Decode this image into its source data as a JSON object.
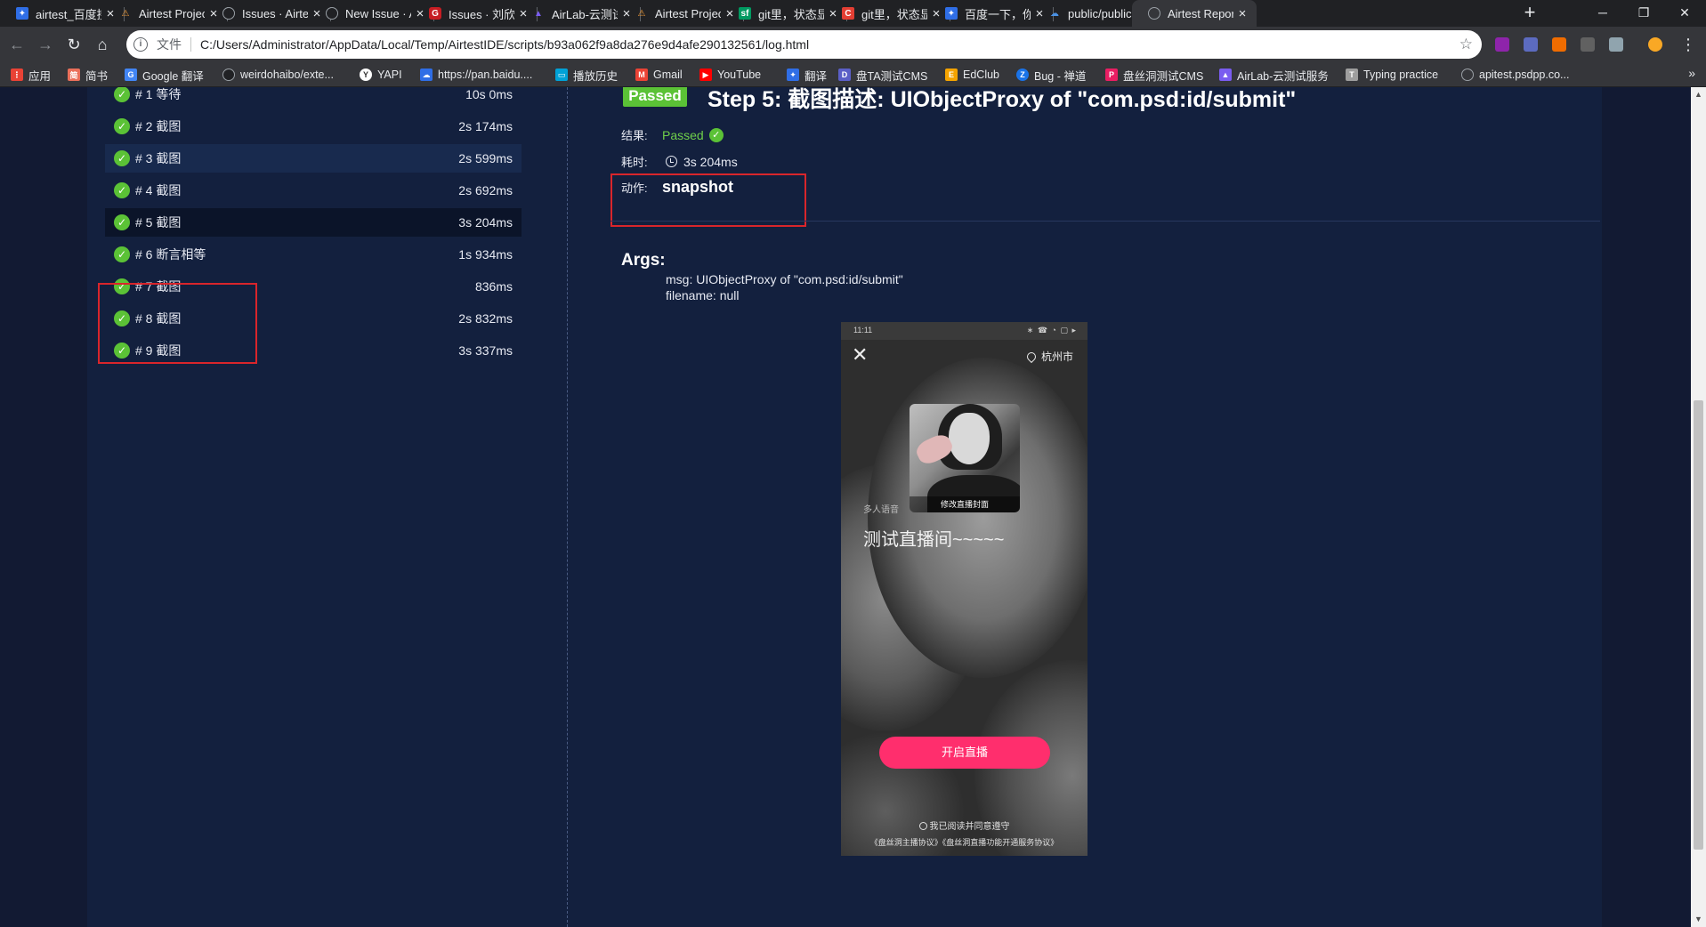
{
  "browser": {
    "tabs": [
      {
        "label": "airtest_百度搜索",
        "icon": "baidu-icon",
        "color": "#2f6ee6"
      },
      {
        "label": "Airtest Project",
        "icon": "airtest-icon",
        "color": "#f29c38"
      },
      {
        "label": "Issues · AirtestProject",
        "icon": "github-icon",
        "color": "#202124"
      },
      {
        "label": "New Issue · AirtestProject",
        "icon": "github-icon",
        "color": "#202124"
      },
      {
        "label": "Issues · 刘欣/AirLab",
        "icon": "gitee-icon",
        "color": "#c71d23"
      },
      {
        "label": "AirLab-云测试服务",
        "icon": "airlab-icon",
        "color": "#7a5cf0"
      },
      {
        "label": "Airtest Project",
        "icon": "airtest-icon",
        "color": "#f29c38"
      },
      {
        "label": "git里，状态显示",
        "icon": "segmentfault-icon",
        "color": "#009a61"
      },
      {
        "label": "git里，状态显示",
        "icon": "csdn-icon",
        "color": "#e33e33"
      },
      {
        "label": "百度一下，你就知道",
        "icon": "baidu-icon",
        "color": "#2f6ee6"
      },
      {
        "label": "public/public",
        "icon": "cloud-icon",
        "color": "#4a90e2"
      },
      {
        "label": "Airtest Report",
        "icon": "globe-icon",
        "color": "#9aa0a6"
      }
    ],
    "address": {
      "protocol_label": "文件",
      "url": "C:/Users/Administrator/AppData/Local/Temp/AirtestIDE/scripts/b93a062f9a8da276e9d4afe290132561/log.html"
    },
    "bookmarks": [
      {
        "label": "应用",
        "icon": "apps-icon",
        "color": "#e94235"
      },
      {
        "label": "简书",
        "icon": "jianshu-icon",
        "color": "#ea6f5a"
      },
      {
        "label": "Google 翻译",
        "icon": "google-translate-icon",
        "color": "#4285f4"
      },
      {
        "label": "weirdohaibo/exte...",
        "icon": "github-icon",
        "color": "#202124"
      },
      {
        "label": "YAPI",
        "icon": "yapi-icon",
        "color": "#ffffff"
      },
      {
        "label": "https://pan.baidu....",
        "icon": "baidu-pan-icon",
        "color": "#2f6ee6"
      },
      {
        "label": "播放历史",
        "icon": "bilibili-icon",
        "color": "#00a1d6"
      },
      {
        "label": "Gmail",
        "icon": "gmail-icon",
        "color": "#ea4335"
      },
      {
        "label": "YouTube",
        "icon": "youtube-icon",
        "color": "#ff0000"
      },
      {
        "label": "翻译",
        "icon": "baidu-translate-icon",
        "color": "#2f6ee6"
      },
      {
        "label": "盘TA测试CMS",
        "icon": "cms-icon",
        "color": "#5b5fc7"
      },
      {
        "label": "EdClub",
        "icon": "edclub-icon",
        "color": "#f4a300"
      },
      {
        "label": "Bug - 禅道",
        "icon": "zentao-icon",
        "color": "#1a73e8"
      },
      {
        "label": "盘丝洞测试CMS",
        "icon": "pansi-icon",
        "color": "#e91e63"
      },
      {
        "label": "AirLab-云测试服务",
        "icon": "airlab-icon",
        "color": "#7a5cf0"
      },
      {
        "label": "Typing practice",
        "icon": "typing-icon",
        "color": "#9e9e9e"
      },
      {
        "label": "apitest.psdpp.co...",
        "icon": "globe-icon",
        "color": "#9aa0a6"
      }
    ]
  },
  "steps": [
    {
      "label": "# 1  等待",
      "duration": "10s 0ms"
    },
    {
      "label": "# 2  截图",
      "duration": "2s 174ms"
    },
    {
      "label": "# 3  截图",
      "duration": "2s 599ms"
    },
    {
      "label": "# 4  截图",
      "duration": "2s 692ms"
    },
    {
      "label": "# 5  截图",
      "duration": "3s 204ms"
    },
    {
      "label": "# 6  断言相等",
      "duration": "1s 934ms"
    },
    {
      "label": "# 7  截图",
      "duration": "836ms"
    },
    {
      "label": "# 8  截图",
      "duration": "2s 832ms"
    },
    {
      "label": "# 9  截图",
      "duration": "3s 337ms"
    }
  ],
  "detail": {
    "badge": "Passed",
    "title": "Step 5: 截图描述: UIObjectProxy of \"com.psd:id/submit\"",
    "result_label": "结果:",
    "result_value": "Passed",
    "time_label": "耗时:",
    "time_value": "3s 204ms",
    "action_label": "动作:",
    "action_value": "snapshot",
    "args_title": "Args:",
    "args": [
      "msg: UIObjectProxy of \"com.psd:id/submit\"",
      "filename: null"
    ]
  },
  "phone": {
    "status_time": "11:11",
    "status_icons": "∗ ☎ ◔ ▢ ▸",
    "location": "杭州市",
    "cover_label": "修改直播封面",
    "room_type": "多人语音",
    "room_title": "测试直播间~~~~~",
    "start_button": "开启直播",
    "agree_text": "我已阅读并同意遵守",
    "terms_text": "《盘丝洞主播协议》《盘丝洞直播功能开通服务协议》"
  },
  "colors": {
    "page_bg": "#121a33",
    "panel_bg": "#13203e",
    "pass_green": "#5bc236",
    "highlight_red": "#d9252b",
    "live_button": "#ff2e6d"
  }
}
